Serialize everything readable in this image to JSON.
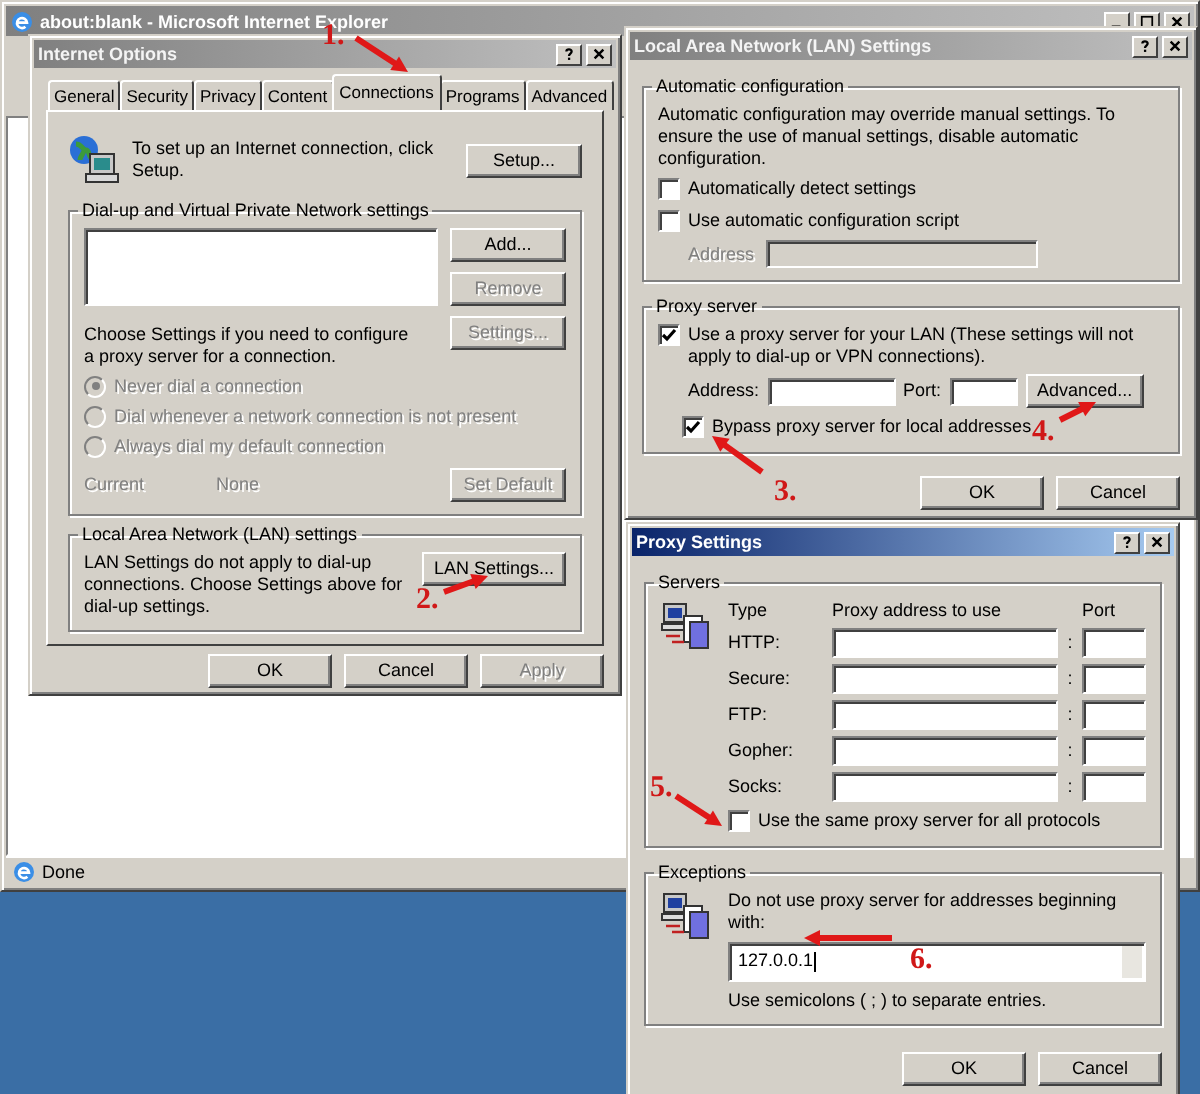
{
  "browser": {
    "title": "about:blank - Microsoft Internet Explorer",
    "status": "Done"
  },
  "internet_options": {
    "title": "Internet Options",
    "tabs": [
      {
        "label": "General",
        "selected": false
      },
      {
        "label": "Security",
        "selected": false
      },
      {
        "label": "Privacy",
        "selected": false
      },
      {
        "label": "Content",
        "selected": false
      },
      {
        "label": "Connections",
        "selected": true
      },
      {
        "label": "Programs",
        "selected": false
      },
      {
        "label": "Advanced",
        "selected": false
      }
    ],
    "setup": {
      "text": "To set up an Internet connection, click Setup.",
      "button": "Setup..."
    },
    "dialup": {
      "legend": "Dial-up and Virtual Private Network settings",
      "buttons": [
        {
          "label": "Add...",
          "disabled": false
        },
        {
          "label": "Remove",
          "disabled": true
        },
        {
          "label": "Settings...",
          "disabled": true
        }
      ],
      "hint": "Choose Settings if you need to configure a proxy server for a connection.",
      "options": [
        {
          "label": "Never dial a connection",
          "selected": true,
          "disabled": true
        },
        {
          "label": "Dial whenever a network connection is not present",
          "selected": false,
          "disabled": true
        },
        {
          "label": "Always dial my default connection",
          "selected": false,
          "disabled": true
        }
      ],
      "current_label": "Current",
      "current_value": "None",
      "default_button": {
        "label": "Set Default",
        "disabled": true
      }
    },
    "lan": {
      "legend": "Local Area Network (LAN) settings",
      "text": "LAN Settings do not apply to dial-up connections. Choose Settings above for dial-up settings.",
      "button": "LAN Settings..."
    },
    "buttons": [
      {
        "label": "OK",
        "disabled": false
      },
      {
        "label": "Cancel",
        "disabled": false
      },
      {
        "label": "Apply",
        "disabled": true
      }
    ]
  },
  "lan_settings": {
    "title": "Local Area Network (LAN) Settings",
    "auto": {
      "legend": "Automatic configuration",
      "text": "Automatic configuration may override manual settings.  To ensure the use of manual settings, disable automatic configuration.",
      "options": [
        {
          "label": "Automatically detect settings",
          "checked": false
        },
        {
          "label": "Use automatic configuration script",
          "checked": false
        }
      ],
      "address_label": "Address",
      "address_disabled": true
    },
    "proxy": {
      "legend": "Proxy server",
      "use_proxy": {
        "label": "Use a proxy server for your LAN (These settings will not apply to dial-up or VPN connections).",
        "checked": true
      },
      "address_label": "Address:",
      "port_label": "Port:",
      "advanced": "Advanced...",
      "bypass": {
        "label": "Bypass proxy server for local addresses",
        "checked": true
      }
    },
    "buttons": [
      "OK",
      "Cancel"
    ]
  },
  "proxy_settings": {
    "title": "Proxy Settings",
    "servers": {
      "legend": "Servers",
      "headers": [
        "Type",
        "Proxy address to use",
        "Port"
      ],
      "rows": [
        {
          "type": "HTTP:",
          "separator": ":"
        },
        {
          "type": "Secure:",
          "separator": ":"
        },
        {
          "type": "FTP:",
          "separator": ":"
        },
        {
          "type": "Gopher:",
          "separator": ":"
        },
        {
          "type": "Socks:",
          "separator": ":"
        }
      ],
      "same_proxy": {
        "label": "Use the same proxy server for all protocols",
        "checked": false
      }
    },
    "exceptions": {
      "legend": "Exceptions",
      "text": "Do not use proxy server for addresses beginning with:",
      "value": "127.0.0.1",
      "note": "Use semicolons ( ; ) to separate entries."
    },
    "buttons": [
      "OK",
      "Cancel"
    ]
  },
  "annotations": [
    {
      "label": "1."
    },
    {
      "label": "2."
    },
    {
      "label": "3."
    },
    {
      "label": "4."
    },
    {
      "label": "5."
    },
    {
      "label": "6."
    }
  ]
}
